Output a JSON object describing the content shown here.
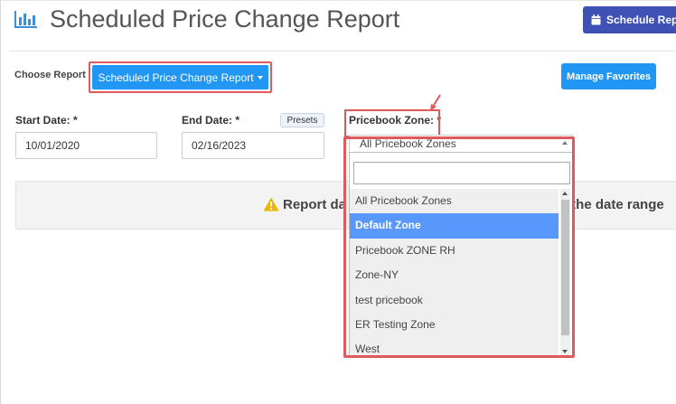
{
  "header": {
    "title": "Scheduled Price Change Report",
    "icon": "bar-chart-icon",
    "schedule_button": "Schedule Report",
    "schedule_icon": "calendar-icon",
    "accent": "#3f51b5"
  },
  "toolbar": {
    "choose_label": "Choose Report",
    "report_button": "Scheduled Price Change Report",
    "favorites_button": "Manage Favorites",
    "button_color": "#2196f3"
  },
  "filters": {
    "start_label": "Start Date: *",
    "start_value": "10/01/2020",
    "end_label": "End Date: *",
    "end_value": "02/16/2023",
    "presets": "Presets",
    "zone_label": "Pricebook Zone: *",
    "zone_selected": "All Pricebook Zones"
  },
  "dropdown": {
    "search_value": "",
    "options": [
      "All Pricebook Zones",
      "Default Zone",
      "Pricebook ZONE RH",
      "Zone-NY",
      "test pricebook",
      "ER Testing Zone",
      "West"
    ],
    "highlighted": "Default Zone",
    "highlight_color": "#5897fb"
  },
  "report": {
    "message_left": "Report da",
    "message_right": "t the date range",
    "icon": "warning-icon"
  },
  "annotations": {
    "highlight_color": "#e0595d"
  }
}
